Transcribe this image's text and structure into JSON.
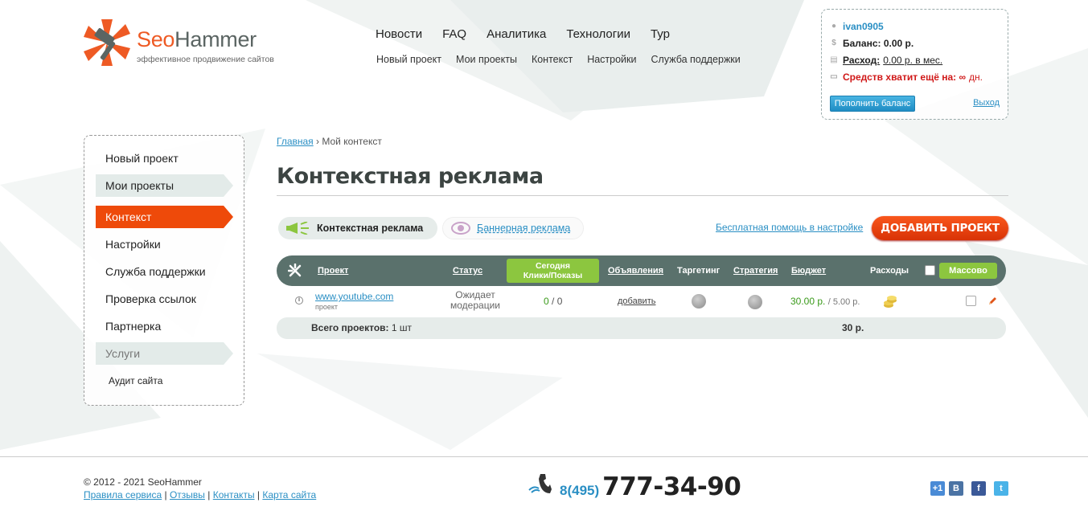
{
  "brand": {
    "name_part1": "Seo",
    "name_part2": "Hammer",
    "tagline": "эффективное продвижение сайтов"
  },
  "topnav": [
    "Новости",
    "FAQ",
    "Аналитика",
    "Технологии",
    "Тур"
  ],
  "subnav": [
    "Новый проект",
    "Мои проекты",
    "Контекст",
    "Настройки",
    "Служба поддержки"
  ],
  "user": {
    "username": "ivan0905",
    "balance": "Баланс: 0.00 р.",
    "expense_label": "Расход:",
    "expense_value": "0.00 р. в мес.",
    "enough_label": "Средств хватит ещё на: ∞",
    "enough_unit": "дн.",
    "topup_button": "Пополнить баланс",
    "logout": "Выход"
  },
  "sidebar": [
    {
      "label": "Новый проект",
      "state": "normal"
    },
    {
      "label": "Мои проекты",
      "state": "arrow"
    },
    {
      "label": "Контекст",
      "state": "active"
    },
    {
      "label": "Настройки",
      "state": "normal"
    },
    {
      "label": "Служба поддержки",
      "state": "normal"
    },
    {
      "label": "Проверка ссылок",
      "state": "normal"
    },
    {
      "label": "Партнерка",
      "state": "normal"
    },
    {
      "label": "Услуги",
      "state": "muted"
    },
    {
      "label": "Аудит сайта",
      "state": "small"
    }
  ],
  "breadcrumb": {
    "home": "Главная",
    "separator": "›",
    "current": "Мой контекст"
  },
  "page_title": "Контекстная реклама",
  "tabs": {
    "context": "Контекстная реклама",
    "banner": "Баннерная реклама"
  },
  "help_link": "Бесплатная помощь в настройке",
  "add_project_button": "ДОБАВИТЬ ПРОЕКТ",
  "table": {
    "headers": {
      "project": "Проект",
      "status": "Статус",
      "today_line1": "Сегодня",
      "today_line2": "Клики/Показы",
      "ads": "Объявления",
      "targeting": "Таргетинг",
      "strategy": "Стратегия",
      "budget": "Бюджет",
      "expenses": "Расходы",
      "mass": "Массово"
    },
    "rows": [
      {
        "project": "www.youtube.com",
        "project_sub": "проект",
        "status_line1": "Ожидает",
        "status_line2": "модерации",
        "clicks": "0",
        "impressions": "0",
        "ads": "добавить",
        "budget": "30.00 р.",
        "budget_sub": "5.00 р."
      }
    ],
    "total_label": "Всего проектов:",
    "total_count": "1 шт",
    "total_sum": "30 р."
  },
  "footer": {
    "copyright": "© 2012 - 2021 SeoHammer",
    "links": [
      "Правила сервиса",
      "Отзывы",
      "Контакты",
      "Карта сайта"
    ],
    "phone_code": "8(495)",
    "phone_number": "777-34-90"
  },
  "colors": {
    "accent": "#ee4a0a",
    "link": "#2a8fc4",
    "green": "#8cc63f",
    "header_bg": "#5a716c"
  }
}
